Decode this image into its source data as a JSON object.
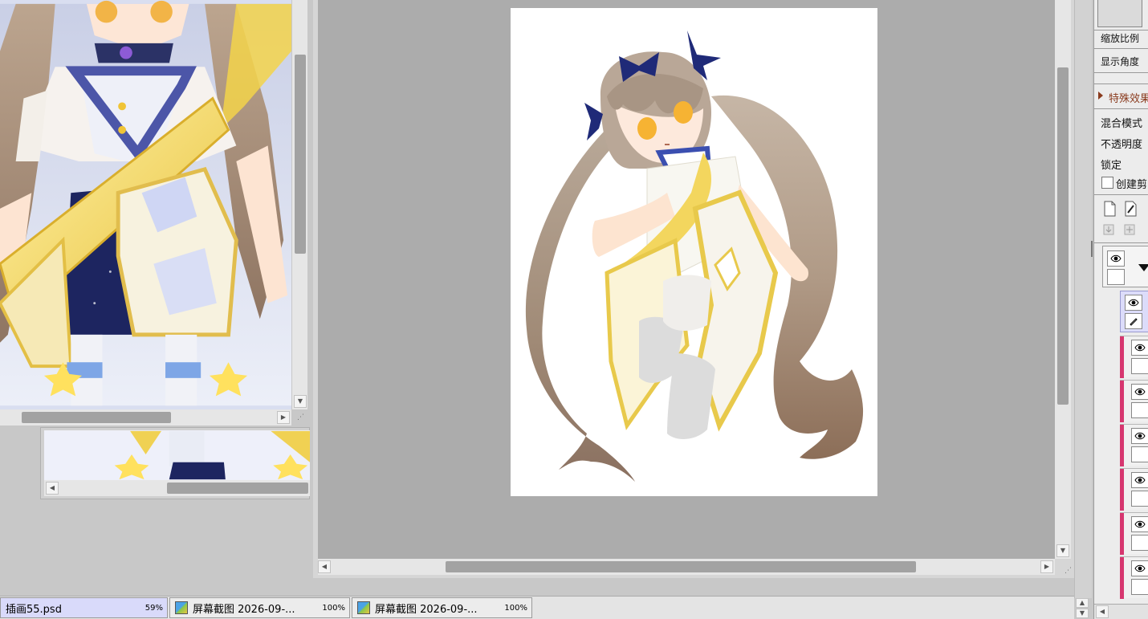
{
  "right_panel": {
    "zoom_label": "缩放比例",
    "angle_label": "显示角度",
    "effects_label": "特殊效果",
    "blend_label": "混合模式",
    "opacity_label": "不透明度",
    "lock_label": "锁定",
    "clip_label": "创建剪",
    "layers_count": 6
  },
  "tabs": [
    {
      "name": "插画55.psd",
      "zoom": "59%",
      "active": true
    },
    {
      "name": "屏幕截图 2026-09-...",
      "zoom": "100%",
      "active": false
    },
    {
      "name": "屏幕截图 2026-09-...",
      "zoom": "100%",
      "active": false
    }
  ],
  "colors": {
    "canvas_bg": "#acacac",
    "layer_stripe": "#d6366f",
    "active_tab": "#d9dafa",
    "ribbon_navy": "#1f2a78",
    "hair_brown": "#a88f7c",
    "sash_gold": "#f0d566"
  }
}
